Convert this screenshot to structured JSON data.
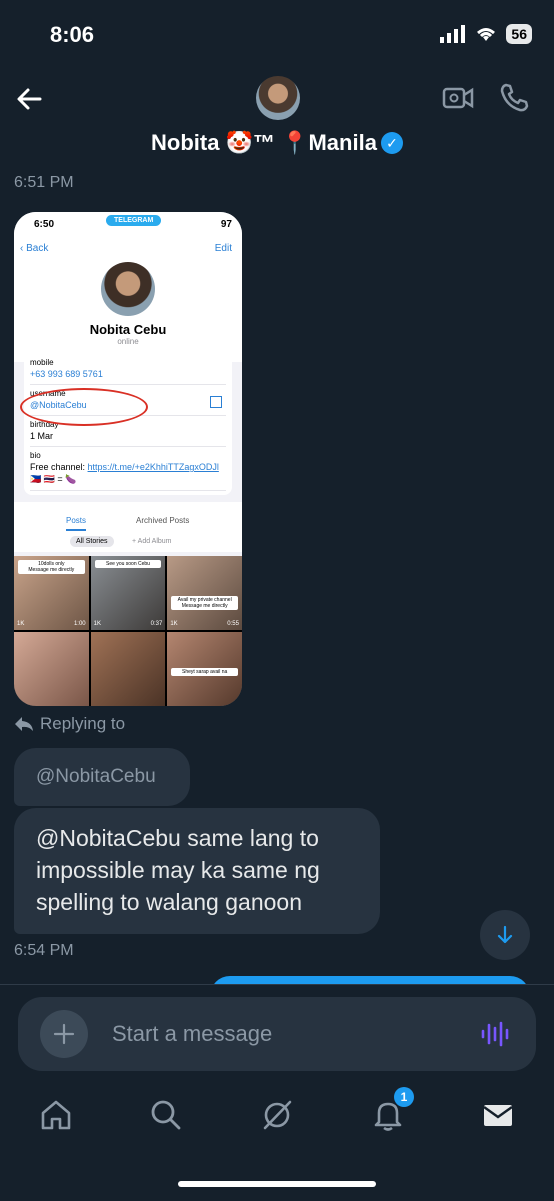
{
  "status_bar": {
    "time": "8:06",
    "battery": "56"
  },
  "header": {
    "name": "Nobita 🤡™ 📍Manila",
    "verified": "✓"
  },
  "messages": {
    "timestamp_1": "6:51 PM",
    "replying_to_label": "Replying to",
    "quoted_handle": "@NobitaCebu",
    "body": "@NobitaCebu  same lang to impossible may ka same ng spelling to walang ganoon",
    "timestamp_2": "6:54 PM"
  },
  "attachment": {
    "status_time": "6:50",
    "telegram_label": "TELEGRAM",
    "battery": "97",
    "back_label": "Back",
    "edit_label": "Edit",
    "profile_name": "Nobita Cebu",
    "presence": "online",
    "mobile_label": "mobile",
    "mobile_value": "+63 993 689 5761",
    "username_label": "username",
    "username_value": "@NobitaCebu",
    "birthday_label": "birthday",
    "birthday_value": "1 Mar",
    "bio_label": "bio",
    "bio_prefix": "Free channel: ",
    "bio_link": "https://t.me/+e2KhhiTTZagxODJl",
    "bio_line2": "🇵🇭 🇹🇭 = 🍆",
    "tab_posts": "Posts",
    "tab_archived": "Archived Posts",
    "chip_all_stories": "All Stories",
    "chip_add_album": "+ Add Album",
    "tiles": [
      {
        "caption": "10dolls only\nMessage me directly",
        "views": "1K",
        "duration": "1:00"
      },
      {
        "caption": "See you soon Cebu",
        "views": "1K",
        "duration": "0:37"
      },
      {
        "caption": "Avail my private channel\nMessage me directly",
        "views": "1K",
        "duration": "0:55"
      },
      {
        "caption": "",
        "views": "",
        "duration": ""
      },
      {
        "caption": "",
        "views": "",
        "duration": ""
      },
      {
        "caption": "Sheyt sarap avail na",
        "views": "",
        "duration": ""
      }
    ]
  },
  "composer": {
    "placeholder": "Start a message"
  },
  "tabbar": {
    "notifications_badge": "1"
  },
  "colors": {
    "background": "#15202b",
    "bubble": "#273340",
    "accent": "#1d9bf0",
    "muted": "#8b98a5",
    "voice": "#7856ff"
  }
}
